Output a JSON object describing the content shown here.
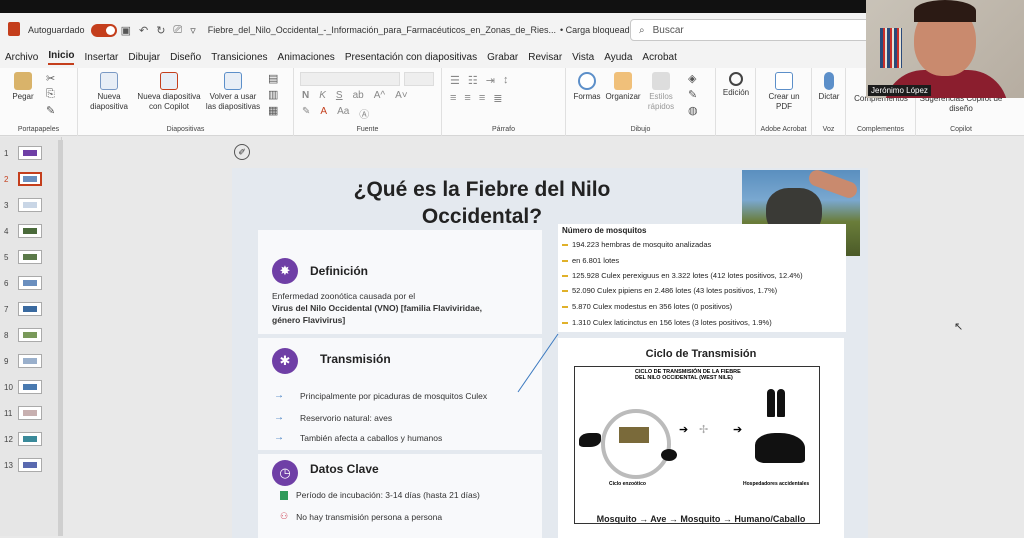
{
  "titlebar": {
    "autosave_label": "Autoguardado",
    "doc_title": "Fiebre_del_Nilo_Occidental_-_Información_para_Farmacéuticos_en_Zonas_de_Ries...",
    "load_status": "• Carga bloqueada",
    "search_placeholder": "Buscar"
  },
  "menu": [
    "Archivo",
    "Inicio",
    "Insertar",
    "Dibujar",
    "Diseño",
    "Transiciones",
    "Animaciones",
    "Presentación con diapositivas",
    "Grabar",
    "Revisar",
    "Vista",
    "Ayuda",
    "Acrobat"
  ],
  "ribbon": {
    "portapapeles": {
      "paste": "Pegar",
      "label": "Portapapeles"
    },
    "diapositivas": {
      "new": "Nueva diapositiva",
      "copilot": "Nueva diapositiva con Copilot",
      "reuse": "Volver a usar las diapositivas",
      "label": "Diapositivas"
    },
    "fuente": {
      "label": "Fuente",
      "n": "N",
      "k": "K",
      "s": "S",
      "ab": "ab",
      "aa": "Aa",
      "a_up": "A^",
      "a_down": "A˅"
    },
    "parrafo": {
      "label": "Párrafo"
    },
    "dibujo": {
      "formas": "Formas",
      "organizar": "Organizar",
      "estilos": "Estilos rápidos",
      "label": "Dibujo"
    },
    "edicion": {
      "label": "Edición"
    },
    "acrobat": {
      "pdf": "Crear un PDF",
      "label": "Adobe Acrobat"
    },
    "voz": {
      "dictar": "Dictar",
      "label": "Voz"
    },
    "complementos": {
      "btn": "Complementos",
      "label": "Complementos"
    },
    "copilot": {
      "btn": "Sugerencias Copilot de diseño",
      "label": "Copilot"
    }
  },
  "thumbnails": [
    "1",
    "2",
    "3",
    "4",
    "5",
    "6",
    "7",
    "8",
    "9",
    "10",
    "11",
    "12",
    "13"
  ],
  "selected_slide": 2,
  "slide": {
    "title_line1": "¿Qué es la Fiebre del Nilo",
    "title_line2": "Occidental?",
    "definicion": {
      "heading": "Definición",
      "line1": "Enfermedad zoonótica causada por el",
      "line2": "Virus del Nilo Occidental (VNO) [familia Flaviviridae,",
      "line3": "género Flavivirus]"
    },
    "transmision": {
      "heading": "Transmisión",
      "items": [
        "Principalmente por picaduras de mosquitos  Culex",
        "Reservorio natural: aves",
        "También afecta a caballos y humanos"
      ]
    },
    "datos": {
      "heading": "Datos Clave",
      "items": [
        "Período de incubación: 3-14 días (hasta 21 días)",
        "No hay transmisión persona a persona"
      ]
    },
    "mosquitos": {
      "heading": "Número de mosquitos",
      "rows": [
        "194.223 hembras de mosquito analizadas",
        "en 6.801 lotes",
        "125.928 Culex perexiguus en 3.322 lotes (412 lotes positivos, 12.4%)",
        "52.090 Culex pipiens en 2.486 lotes (43 lotes positivos, 1.7%)",
        "5.870 Culex modestus en 356 lotes (0 positivos)",
        "1.310 Culex laticinctus en 156 lotes (3 lotes positivos, 1.9%)"
      ]
    },
    "ciclo": {
      "heading": "Ciclo de Transmisión",
      "diagram_title": "CICLO DE TRANSMISIÓN DE LA FIEBRE DEL NILO OCCIDENTAL (WEST NILE)",
      "enzootic": "Ciclo enzoótico",
      "accidental": "Hospedadores accidentales",
      "flow": "Mosquito → Ave → Mosquito → Humano/Caballo"
    }
  },
  "webcam": {
    "name": "Jerónimo López"
  }
}
